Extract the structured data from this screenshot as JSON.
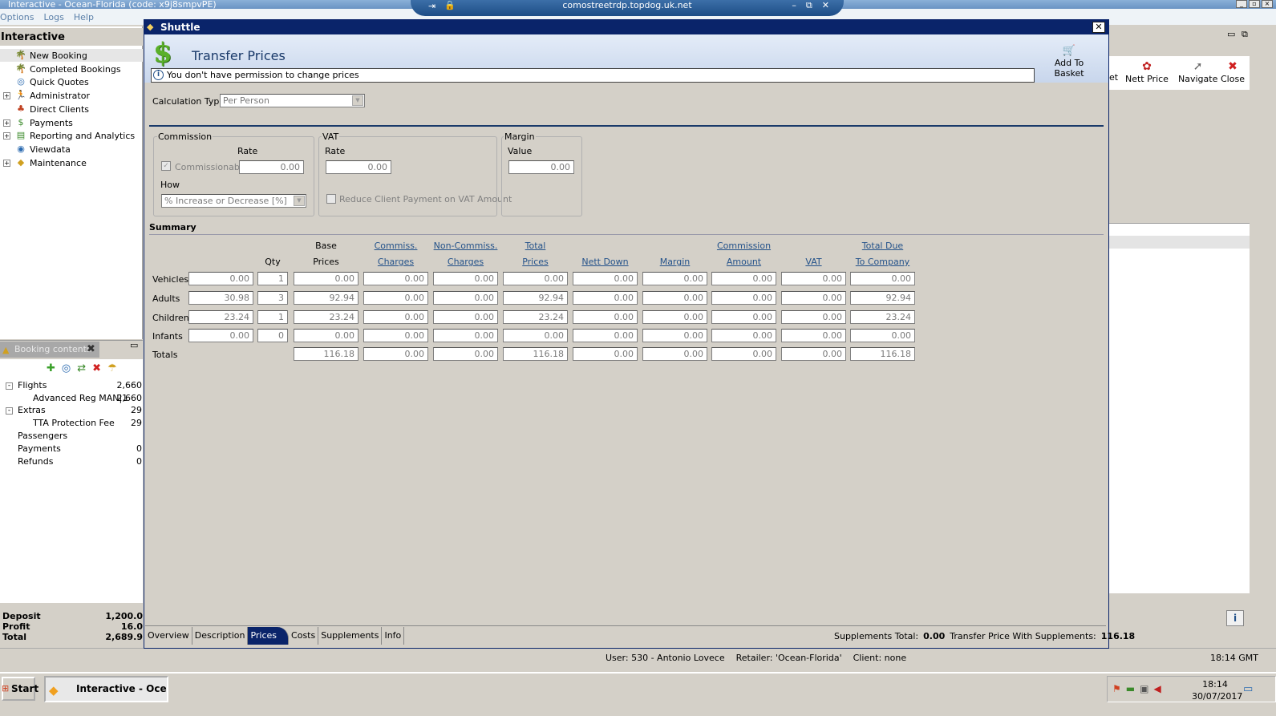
{
  "app": {
    "title": "Interactive - Ocean-Florida (code: x9j8smpvPE)",
    "menu": [
      "Options",
      "Logs",
      "Help"
    ]
  },
  "rdp": {
    "host": "comostreetrdp.topdog.uk.net"
  },
  "nav": {
    "title": "Interactive",
    "items": [
      {
        "label": "New Booking",
        "expandable": false,
        "selected": true,
        "icon": "new-booking-icon"
      },
      {
        "label": "Completed Bookings",
        "expandable": false,
        "icon": "completed-bookings-icon"
      },
      {
        "label": "Quick Quotes",
        "expandable": false,
        "icon": "quick-quotes-icon"
      },
      {
        "label": "Administrator",
        "expandable": true,
        "icon": "administrator-icon"
      },
      {
        "label": "Direct Clients",
        "expandable": false,
        "icon": "direct-clients-icon"
      },
      {
        "label": "Payments",
        "expandable": true,
        "icon": "payments-icon"
      },
      {
        "label": "Reporting and Analytics",
        "expandable": true,
        "icon": "reporting-icon"
      },
      {
        "label": "Viewdata",
        "expandable": false,
        "icon": "viewdata-icon"
      },
      {
        "label": "Maintenance",
        "expandable": true,
        "icon": "maintenance-icon"
      }
    ]
  },
  "booking": {
    "tab_label": "Booking contents",
    "rows": [
      {
        "label": "Flights",
        "value": "2,660",
        "expander": "-"
      },
      {
        "label": "Advanced Reg MAN|1",
        "value": "2,660",
        "expander": ""
      },
      {
        "label": "Extras",
        "value": "29",
        "expander": "-"
      },
      {
        "label": "TTA Protection Fee",
        "value": "29",
        "expander": ""
      },
      {
        "label": "Passengers",
        "value": "",
        "expander": ""
      },
      {
        "label": "Payments",
        "value": "0",
        "expander": ""
      },
      {
        "label": "Refunds",
        "value": "0",
        "expander": ""
      }
    ],
    "totals": [
      {
        "label": "Deposit",
        "value": "1,200.0"
      },
      {
        "label": "Profit",
        "value": "16.0"
      },
      {
        "label": "Total",
        "value": "2,689.9"
      }
    ]
  },
  "right_toolbar": {
    "partial_label": "et",
    "nett_price": "Nett Price",
    "navigate": "Navigate",
    "close": "Close"
  },
  "shuttle": {
    "window_title": "Shuttle",
    "heading": "Transfer Prices",
    "permission_msg": "You don't have permission to change prices",
    "add_to_basket": "Add To Basket",
    "calc_type_label": "Calculation Type",
    "calc_type_value": "Per Person",
    "commission": {
      "title": "Commission",
      "rate_label": "Rate",
      "commissionable_label": "Commissionable",
      "rate_value": "0.00",
      "how_label": "How",
      "how_value": "% Increase or Decrease   [%]"
    },
    "vat": {
      "title": "VAT",
      "rate_label": "Rate",
      "rate_value": "0.00",
      "reduce_label": "Reduce Client Payment on VAT Amount"
    },
    "margin": {
      "title": "Margin",
      "value_label": "Value",
      "value": "0.00"
    },
    "summary": {
      "title": "Summary",
      "columns": [
        {
          "line1": "",
          "line2": "Qty",
          "link": false
        },
        {
          "line1": "Base",
          "line2": "Prices",
          "link": false
        },
        {
          "line1": "Commiss.",
          "line2": "Charges",
          "link": true
        },
        {
          "line1": "Non-Commiss.",
          "line2": "Charges",
          "link": true
        },
        {
          "line1": "Total",
          "line2": "Prices",
          "link": true
        },
        {
          "line1": "",
          "line2": "Nett Down",
          "link": true
        },
        {
          "line1": "",
          "line2": "Margin",
          "link": true
        },
        {
          "line1": "Commission",
          "line2": "Amount",
          "link": true
        },
        {
          "line1": "",
          "line2": "VAT",
          "link": true
        },
        {
          "line1": "Total Due",
          "line2": "To Company",
          "link": true
        }
      ],
      "rows": [
        {
          "label": "Vehicles",
          "unit": "0.00",
          "qty": "1",
          "values": [
            "0.00",
            "0.00",
            "0.00",
            "0.00",
            "0.00",
            "0.00",
            "0.00",
            "0.00",
            "0.00"
          ]
        },
        {
          "label": "Adults",
          "unit": "30.98",
          "qty": "3",
          "values": [
            "92.94",
            "0.00",
            "0.00",
            "92.94",
            "0.00",
            "0.00",
            "0.00",
            "0.00",
            "92.94"
          ]
        },
        {
          "label": "Children",
          "unit": "23.24",
          "qty": "1",
          "values": [
            "23.24",
            "0.00",
            "0.00",
            "23.24",
            "0.00",
            "0.00",
            "0.00",
            "0.00",
            "23.24"
          ]
        },
        {
          "label": "Infants",
          "unit": "0.00",
          "qty": "0",
          "values": [
            "0.00",
            "0.00",
            "0.00",
            "0.00",
            "0.00",
            "0.00",
            "0.00",
            "0.00",
            "0.00"
          ]
        }
      ],
      "totals": {
        "label": "Totals",
        "values": [
          "116.18",
          "0.00",
          "0.00",
          "116.18",
          "0.00",
          "0.00",
          "0.00",
          "0.00",
          "116.18"
        ]
      }
    },
    "tabs": [
      "Overview",
      "Description",
      "Prices",
      "Costs",
      "Supplements",
      "Info"
    ],
    "active_tab": "Prices",
    "supplements_total_label": "Supplements Total:",
    "supplements_total_value": "0.00",
    "transfer_price_label": "Transfer Price With Supplements:",
    "transfer_price_value": "116.18"
  },
  "status": {
    "user": "User: 530 - Antonio Lovece",
    "retailer": "Retailer: 'Ocean-Florida'",
    "client": "Client: none",
    "time": "18:14 GMT"
  },
  "taskbar": {
    "start": "Start",
    "app": "Interactive - Ocea...",
    "clock_time": "18:14",
    "clock_date": "30/07/2017"
  }
}
